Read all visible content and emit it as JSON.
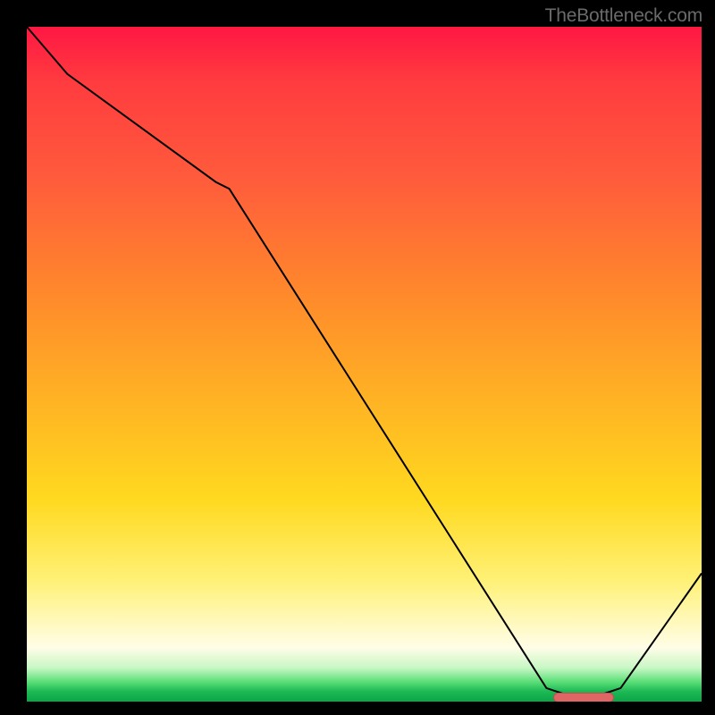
{
  "watermark": "TheBottleneck.com",
  "marker_color": "#e06666",
  "marker_border": "#c44d4d",
  "chart_data": {
    "type": "line",
    "title": "",
    "xlabel": "",
    "ylabel": "",
    "xlim": [
      0,
      100
    ],
    "ylim": [
      0,
      100
    ],
    "grid": false,
    "series": [
      {
        "name": "bottleneck-curve",
        "x": [
          0,
          6,
          28,
          30,
          77,
          80,
          85,
          88,
          100
        ],
        "values": [
          100,
          93,
          77,
          76,
          2,
          1,
          1,
          2,
          19
        ]
      }
    ],
    "marker": {
      "name": "optimal-range",
      "x_start": 78,
      "x_end": 87,
      "y": 0.7
    },
    "background_scale": {
      "top_color": "#ff1744",
      "bottom_color": "#0aa648"
    }
  }
}
